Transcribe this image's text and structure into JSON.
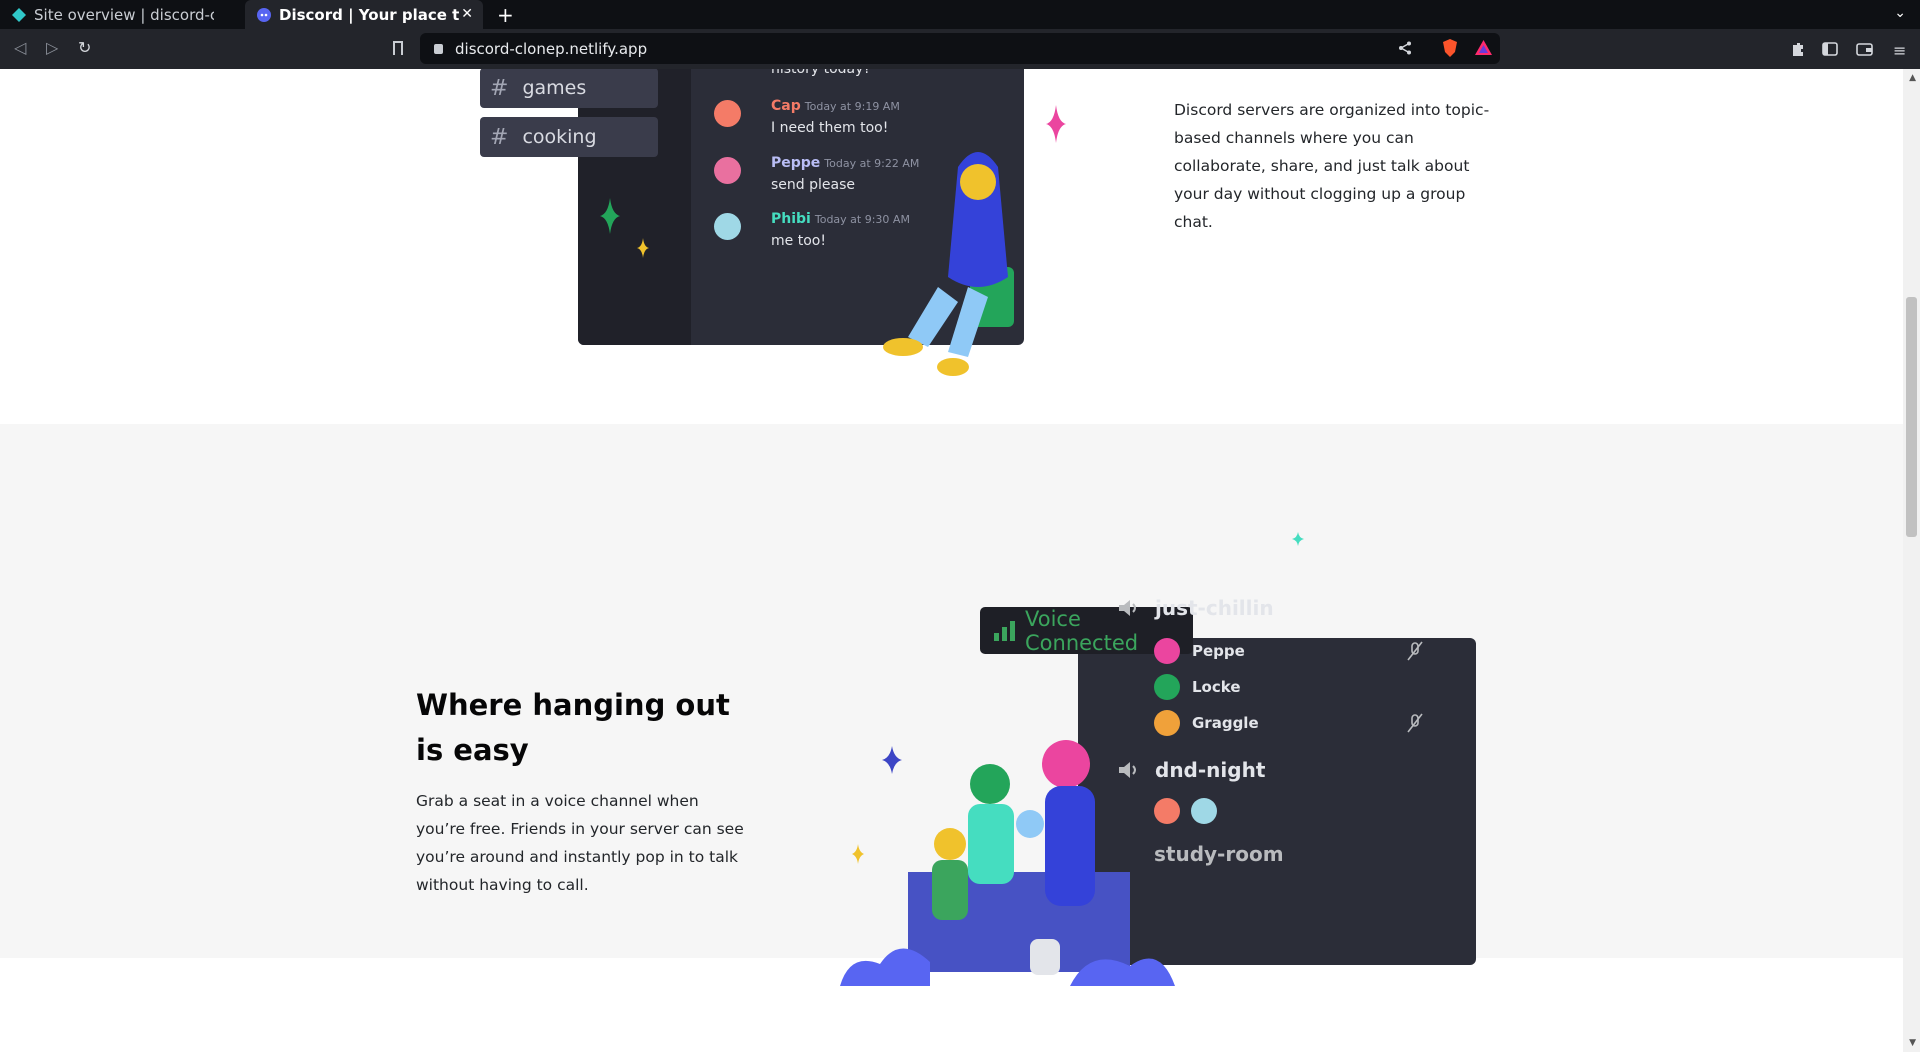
{
  "browser": {
    "tabs": [
      {
        "label": "Site overview | discord-clonep"
      },
      {
        "label": "Discord | Your place to Talk"
      }
    ],
    "new_tab_symbol": "+",
    "close_symbol": "✕",
    "url": "discord-clonep.netlify.app"
  },
  "text_channels": [
    "games",
    "cooking"
  ],
  "chat": {
    "top_partial_text": "history today?",
    "messages": [
      {
        "author": "Cap",
        "time": "Today at 9:19 AM",
        "text": "I need them too!",
        "color": "#f47b67"
      },
      {
        "author": "Peppe",
        "time": "Today at 9:22 AM",
        "text": "send please",
        "color": "#b9bdf5"
      },
      {
        "author": "Phibi",
        "time": "Today at 9:30 AM",
        "text": "me too!",
        "color": "#45ddc0"
      }
    ]
  },
  "section_channels": {
    "description": "Discord servers are organized into topic-based channels where you can collaborate, share, and just talk about your day without clogging up a group chat."
  },
  "section_voice": {
    "heading": "Where hanging out is easy",
    "description": "Grab a seat in a voice channel when you’re free. Friends in your server can see you’re around and instantly pop in to talk without having to call."
  },
  "voice": {
    "badge": "Voice Connected",
    "badge_color": "#3ba55d",
    "channels": [
      {
        "name": "just-chillin"
      },
      {
        "name": "dnd-night"
      },
      {
        "name": "study-room"
      }
    ],
    "users": [
      {
        "name": "Peppe",
        "muted": true
      },
      {
        "name": "Locke",
        "muted": false
      },
      {
        "name": "Graggle",
        "muted": true
      }
    ]
  }
}
